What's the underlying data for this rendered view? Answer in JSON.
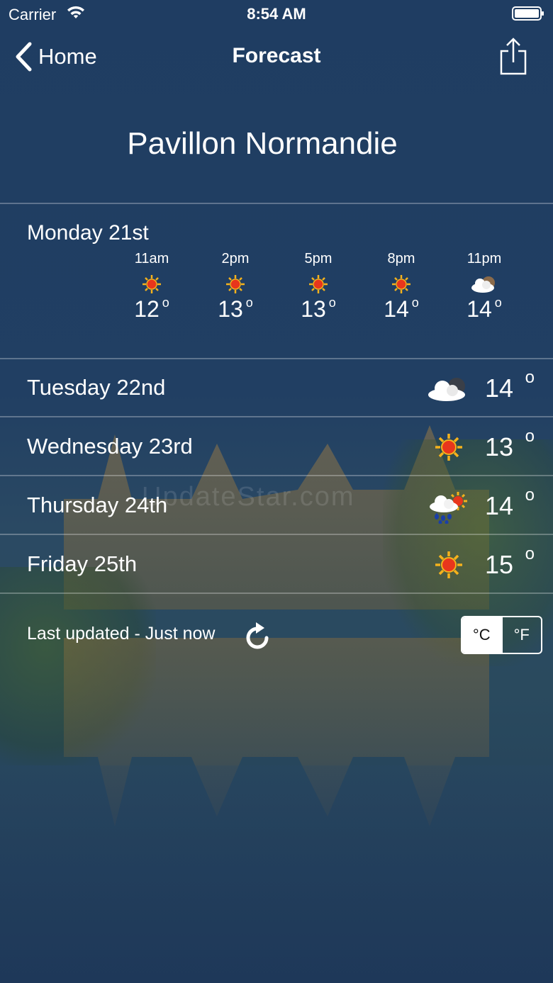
{
  "status_bar": {
    "carrier": "Carrier",
    "time": "8:54 AM",
    "wifi_icon": "wifi-icon",
    "battery_icon": "battery-icon"
  },
  "nav": {
    "back_label": "Home",
    "title": "Forecast",
    "share_icon": "share-icon"
  },
  "location": "Pavillon Normandie",
  "today": {
    "label": "Monday 21st",
    "hours": [
      {
        "time": "11am",
        "temp": "12",
        "icon": "sun-icon"
      },
      {
        "time": "2pm",
        "temp": "13",
        "icon": "sun-icon"
      },
      {
        "time": "5pm",
        "temp": "13",
        "icon": "sun-icon"
      },
      {
        "time": "8pm",
        "temp": "14",
        "icon": "sun-icon"
      },
      {
        "time": "11pm",
        "temp": "14",
        "icon": "cloud-icon"
      }
    ]
  },
  "days": [
    {
      "name": "Tuesday 22nd",
      "temp": "14",
      "icon": "cloud-icon"
    },
    {
      "name": "Wednesday 23rd",
      "temp": "13",
      "icon": "sun-icon"
    },
    {
      "name": "Thursday 24th",
      "temp": "14",
      "icon": "rain-sun-icon"
    },
    {
      "name": "Friday 25th",
      "temp": "15",
      "icon": "sun-icon"
    }
  ],
  "degree_symbol": "o",
  "footer": {
    "last_updated": "Last updated - Just now",
    "unit_celsius": "°C",
    "unit_fahrenheit": "°F",
    "selected_unit": "°C"
  },
  "watermark": "UpdateStar.com",
  "colors": {
    "sun_core": "#e8361c",
    "sun_rays": "#f5b21c",
    "cloud": "#ffffff",
    "rain": "#1a3fa8"
  }
}
